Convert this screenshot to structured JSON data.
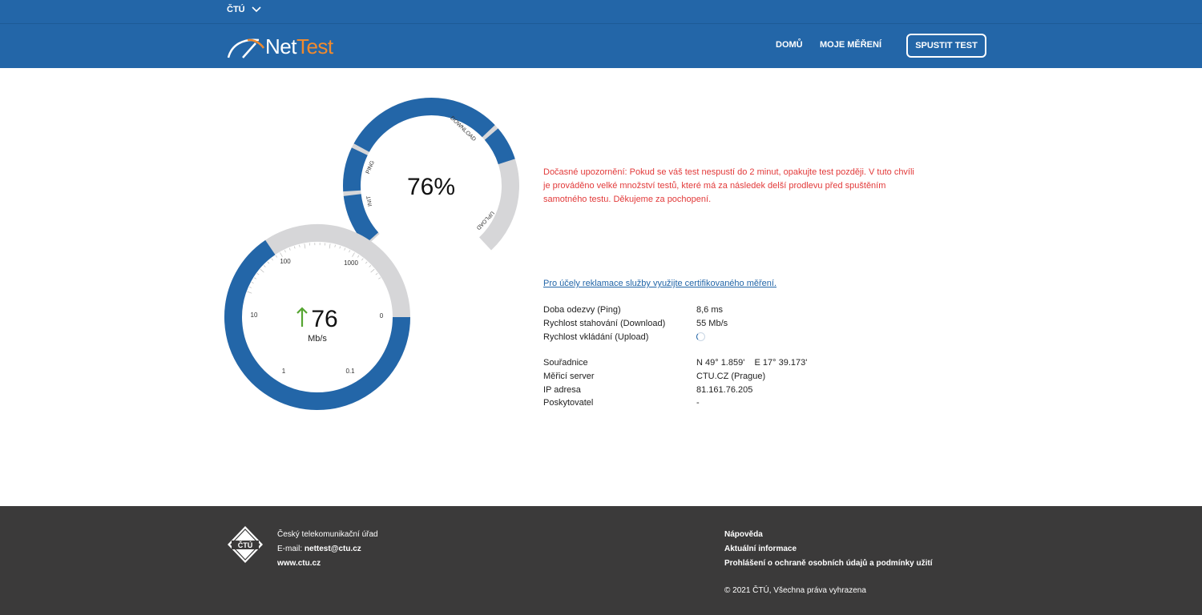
{
  "topbar": {
    "org_label": "ČTÚ"
  },
  "header": {
    "logo_net": "Net",
    "logo_test": "Test",
    "nav_home": "DOMŮ",
    "nav_my_measurements": "MOJE MĚŘENÍ",
    "run_test_button": "SPUSTIT TEST"
  },
  "progress_gauge": {
    "percent_text": "76%",
    "progress_fraction": 0.76,
    "phase_labels": [
      "INIT",
      "PING",
      "DOWNLOAD",
      "UPLOAD"
    ],
    "track_color": "#d6d6d8",
    "fill_color": "#2366a8"
  },
  "speed_gauge": {
    "value": "76",
    "unit": "Mb/s",
    "direction": "up",
    "scale_labels": [
      "0",
      "0.1",
      "1",
      "10",
      "100",
      "1000"
    ],
    "arrow_color": "#55a531"
  },
  "notice": {
    "text": "Dočasné upozornění: Pokud se váš test nespustí do 2 minut, opakujte test později. V tuto chvíli je prováděno velké množství testů, které má za následek delší prodlevu před spuštěním samotného testu. Děkujeme za pochopení.",
    "color": "#e23a3a"
  },
  "cert_link": "Pro účely reklamace služby využijte certifikovaného měření.",
  "results": [
    {
      "label": "Doba odezvy (Ping)",
      "value": "8,6 ms"
    },
    {
      "label": "Rychlost stahování (Download)",
      "value": "55 Mb/s"
    },
    {
      "label": "Rychlost vkládání (Upload)",
      "value": ""
    }
  ],
  "details": [
    {
      "label": "Souřadnice",
      "value": "N 49° 1.859'    E 17° 39.173'"
    },
    {
      "label": "Měřicí server",
      "value": "CTU.CZ (Prague)"
    },
    {
      "label": "IP adresa",
      "value": "81.161.76.205"
    },
    {
      "label": "Poskytovatel",
      "value": "-"
    }
  ],
  "footer": {
    "org_name": "Český telekomunikační úřad",
    "email_label": "E-mail: ",
    "email": "nettest@ctu.cz",
    "website": "www.ctu.cz",
    "logo_text": "ČTÚ",
    "links": [
      "Nápověda",
      "Aktuální informace",
      "Prohlášení o ochraně osobních údajů a podmínky užití"
    ],
    "copyright": "© 2021 ČTÚ, Všechna práva vyhrazena"
  }
}
